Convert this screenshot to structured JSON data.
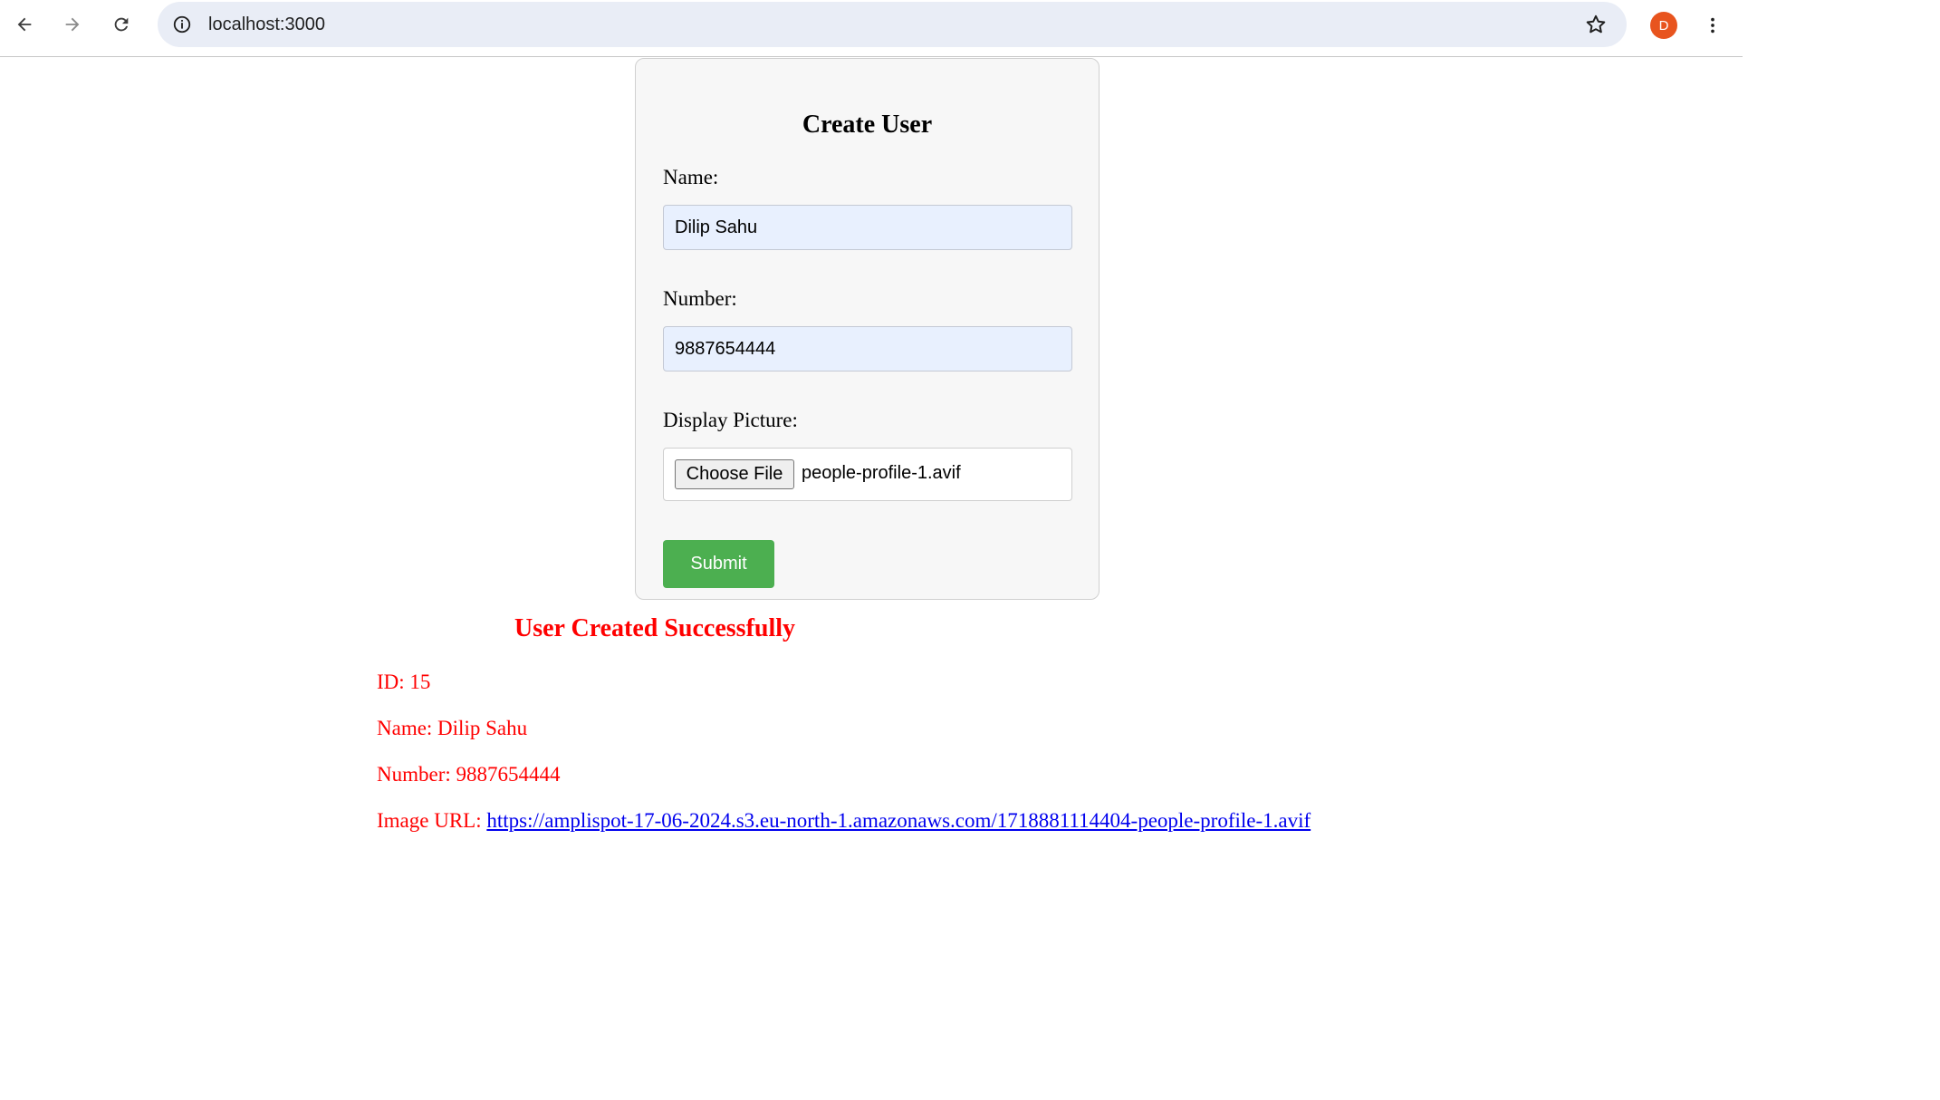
{
  "browser": {
    "url": "localhost:3000",
    "profile_initial": "D",
    "icons": {
      "back": "back-arrow-icon",
      "forward": "forward-arrow-icon",
      "reload": "reload-icon",
      "site_info": "info-icon",
      "bookmark": "star-icon",
      "menu": "kebab-menu-icon"
    },
    "profile_color": "#e8541e"
  },
  "form": {
    "title": "Create User",
    "name_label": "Name:",
    "name_value": "Dilip Sahu",
    "number_label": "Number:",
    "number_value": "9887654444",
    "picture_label": "Display Picture:",
    "choose_file_label": "Choose File",
    "chosen_file": "people-profile-1.avif",
    "submit_label": "Submit",
    "submit_color": "#4caf50"
  },
  "result": {
    "title": "User Created Successfully",
    "id_line": "ID: 15",
    "name_line": "Name: Dilip Sahu",
    "number_line": "Number: 9887654444",
    "image_url_label": "Image URL:",
    "image_url": "https://amplispot-17-06-2024.s3.eu-north-1.amazonaws.com/1718881114404-people-profile-1.avif",
    "text_color": "#ff0000",
    "link_color": "#0000ee"
  }
}
